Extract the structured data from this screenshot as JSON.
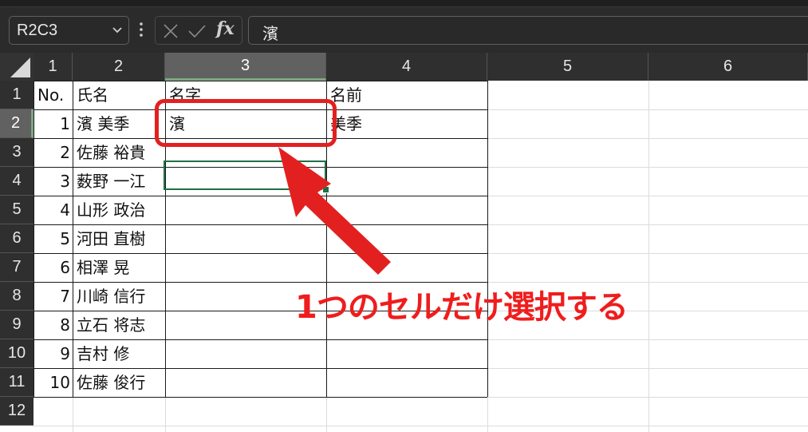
{
  "formula_bar": {
    "name_box": "R2C3",
    "formula_value": "濱",
    "fx_label": "fx",
    "icons": [
      "chevron-down-icon",
      "more-vertical-icon",
      "cancel-x-icon",
      "enter-check-icon",
      "insert-function-icon"
    ]
  },
  "grid": {
    "columns": [
      "1",
      "2",
      "3",
      "4",
      "5",
      "6"
    ],
    "rows": [
      "1",
      "2",
      "3",
      "4",
      "5",
      "6",
      "7",
      "8",
      "9",
      "10",
      "11",
      "12"
    ],
    "selected_column": "3",
    "selected_row": "2",
    "cells": [
      [
        "No.",
        "氏名",
        "名字",
        "名前"
      ],
      [
        "1",
        "濱 美季",
        "濱",
        "美季"
      ],
      [
        "2",
        "佐藤 裕貴",
        "",
        ""
      ],
      [
        "3",
        "薮野 一江",
        "",
        ""
      ],
      [
        "4",
        "山形 政治",
        "",
        ""
      ],
      [
        "5",
        "河田 直樹",
        "",
        ""
      ],
      [
        "6",
        "相澤 晃",
        "",
        ""
      ],
      [
        "7",
        "川崎 信行",
        "",
        ""
      ],
      [
        "8",
        "立石 将志",
        "",
        ""
      ],
      [
        "9",
        "吉村 修",
        "",
        ""
      ],
      [
        "10",
        "佐藤 俊行",
        "",
        ""
      ]
    ]
  },
  "annotation": {
    "caption": "1つのセルだけ選択する",
    "color": "#e32020"
  }
}
